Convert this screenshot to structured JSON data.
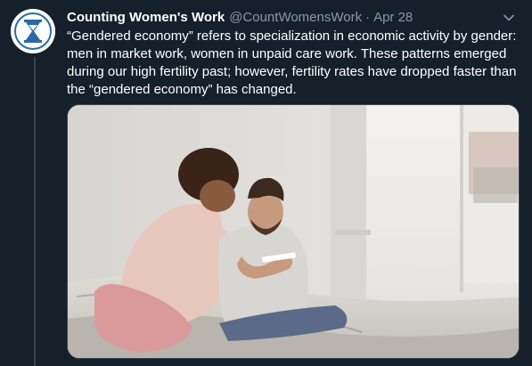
{
  "tweet": {
    "display_name": "Counting Women's Work",
    "handle": "@CountWomensWork",
    "separator": "·",
    "date": "Apr 28",
    "text": "“Gendered economy” refers to specialization in economic activity by gender: men in market work, women in unpaid care work. These patterns emerged during our high fertility past; however, fertility rates have dropped faster than the “gendered economy” has changed.",
    "avatar_icon": "hourglass-logo",
    "menu_icon": "chevron-down-icon",
    "media_description_icon": "photo"
  },
  "colors": {
    "background": "#15202b",
    "primary_text": "#ffffff",
    "secondary_text": "#8899a6",
    "border": "#38444d",
    "logo_blue": "#2b6aa6"
  }
}
